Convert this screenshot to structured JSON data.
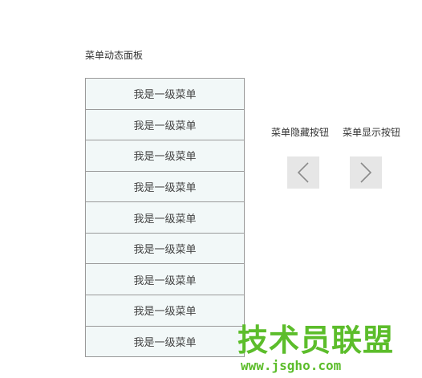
{
  "panel": {
    "title": "菜单动态面板",
    "items": [
      {
        "label": "我是一级菜单"
      },
      {
        "label": "我是一级菜单"
      },
      {
        "label": "我是一级菜单"
      },
      {
        "label": "我是一级菜单"
      },
      {
        "label": "我是一级菜单"
      },
      {
        "label": "我是一级菜单"
      },
      {
        "label": "我是一级菜单"
      },
      {
        "label": "我是一级菜单"
      },
      {
        "label": "我是一级菜单"
      }
    ]
  },
  "controls": {
    "hide_label": "菜单隐藏按钮",
    "show_label": "菜单显示按钮",
    "hide_icon": "chevron-left-icon",
    "show_icon": "chevron-right-icon"
  },
  "watermark": {
    "text": "技术员联盟",
    "url": "www.jsgho.com"
  },
  "colors": {
    "menu_bg": "#f2f8f8",
    "border": "#9a9a9a",
    "button_bg": "#e6e6e6",
    "watermark": "#5cbd2b"
  }
}
